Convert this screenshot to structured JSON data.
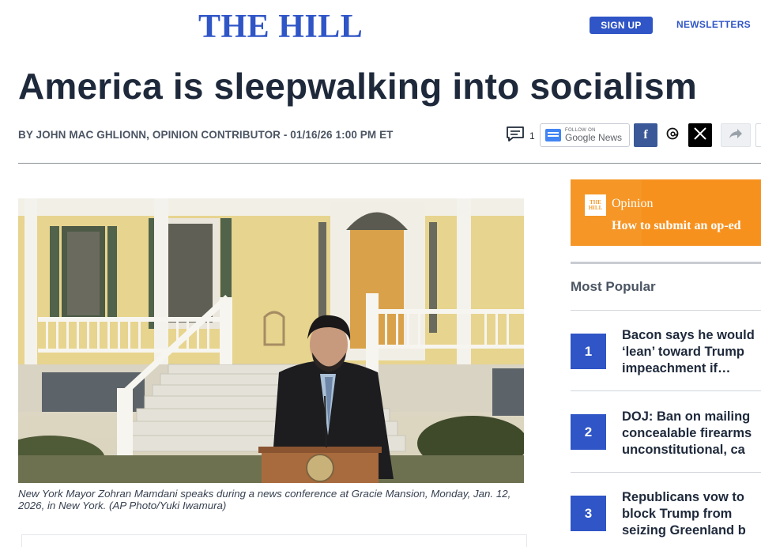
{
  "header": {
    "logo": "THE HILL",
    "signup_label": "SIGN UP",
    "newsletters_label": "NEWSLETTERS"
  },
  "article": {
    "headline": "America is sleepwalking into socialism",
    "byline": "BY JOHN MAC GHLIONN, OPINION CONTRIBUTOR - 01/16/26 1:00 PM ET",
    "comment_count": "1",
    "caption": "New York Mayor Zohran Mamdani speaks during a news conference at Gracie Mansion, Monday, Jan. 12, 2026, in New York. (AP Photo/Yuki Iwamura)"
  },
  "share": {
    "google_news_small": "FOLLOW ON",
    "google_news_label": "Google News",
    "facebook_glyph": "f",
    "icons": [
      "comment-icon",
      "google-news-icon",
      "facebook-icon",
      "threads-icon",
      "x-icon",
      "share-icon"
    ]
  },
  "sidebar": {
    "opinion_logo": "THE HILL",
    "opinion_title": "Opinion",
    "opinion_subtitle": "How to submit an op-ed",
    "most_popular_heading": "Most Popular",
    "popular": [
      {
        "rank": "1",
        "title": "Bacon says he would\n‘lean’ toward Trump\nimpeachment if…"
      },
      {
        "rank": "2",
        "title": "DOJ: Ban on mailing\nconcealable firearms\nunconstitutional, ca"
      },
      {
        "rank": "3",
        "title": "Republicans vow to\nblock Trump from\nseizing Greenland b"
      }
    ]
  },
  "colors": {
    "brand_blue": "#2f55c6",
    "opinion_orange": "#f7911e",
    "facebook_blue": "#3b5998"
  }
}
